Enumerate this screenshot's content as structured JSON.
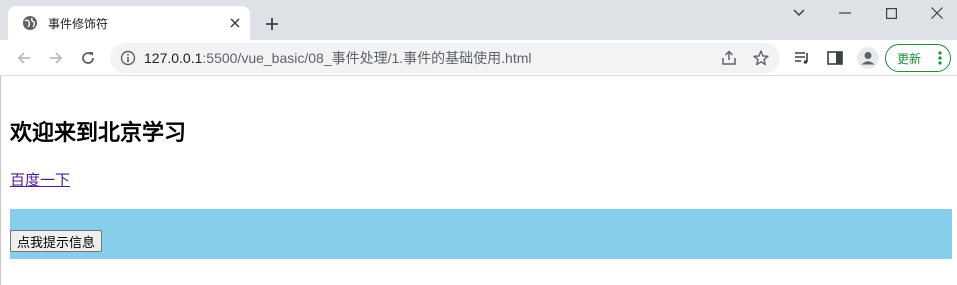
{
  "browser": {
    "tab": {
      "title": "事件修饰符"
    },
    "url": {
      "host": "127.0.0.1",
      "path": ":5500/vue_basic/08_事件处理/1.事件的基础使用.html"
    },
    "update_label": "更新"
  },
  "page": {
    "heading": "欢迎来到北京学习",
    "link_text": "百度一下",
    "button_label": "点我提示信息"
  },
  "colors": {
    "box_background": "#87ceeb",
    "link": "#551a8b",
    "update_accent": "#1e8e3e"
  }
}
